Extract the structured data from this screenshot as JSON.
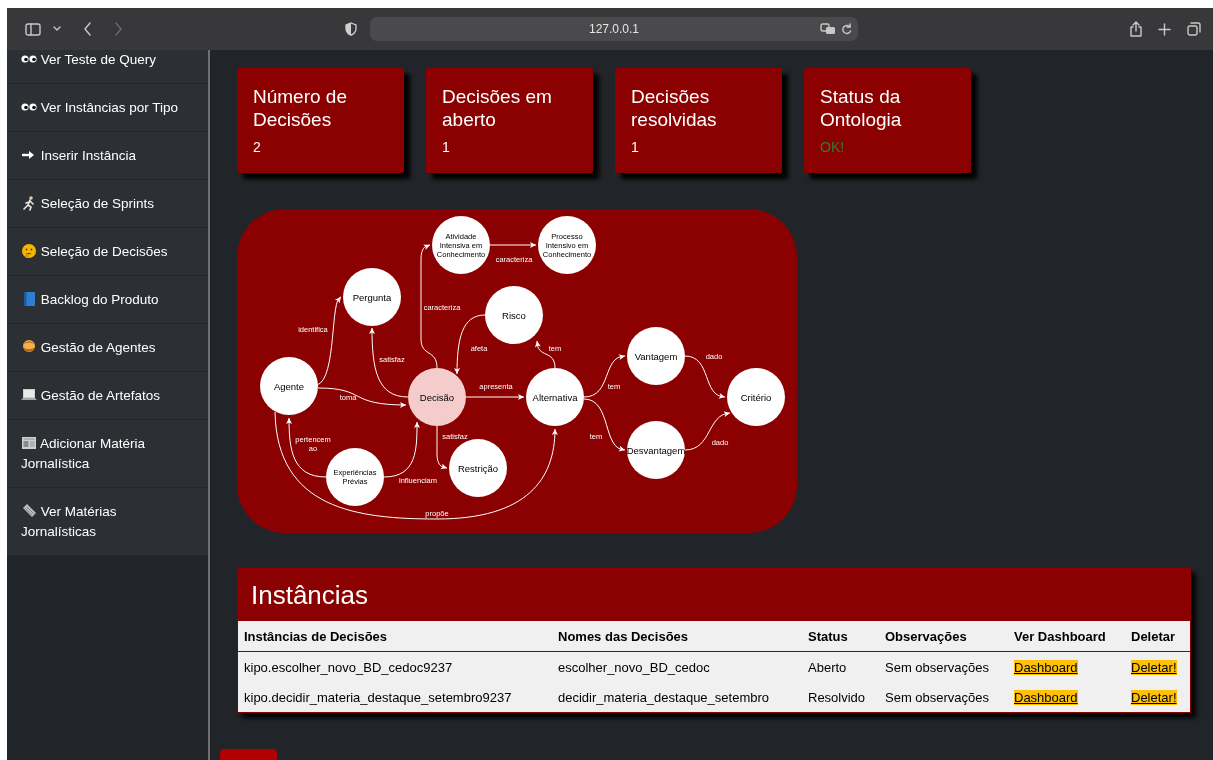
{
  "browser": {
    "url": "127.0.0.1"
  },
  "sidebar": {
    "items": [
      {
        "label": "Ver Teste de Query"
      },
      {
        "label": "Ver Instâncias por Tipo"
      },
      {
        "label": "Inserir Instância"
      },
      {
        "label": "Seleção de Sprints"
      },
      {
        "label": "Seleção de Decisões"
      },
      {
        "label": "Backlog do Produto"
      },
      {
        "label": "Gestão de Agentes"
      },
      {
        "label": "Gestão de Artefatos"
      },
      {
        "label": "Adicionar Matéria Jornalística"
      },
      {
        "label": "Ver Matérias Jornalísticas"
      }
    ]
  },
  "cards": [
    {
      "title": "Número de Decisões",
      "value": "2",
      "kind": "count"
    },
    {
      "title": "Decisões em aberto",
      "value": "1",
      "kind": "count"
    },
    {
      "title": "Decisões resolvidas",
      "value": "1",
      "kind": "count"
    },
    {
      "title": "Status da Ontologia",
      "value": "OK!",
      "kind": "status"
    }
  ],
  "diagram": {
    "nodes": [
      {
        "label": "Agente",
        "highlighted": false
      },
      {
        "label": "Pergunta",
        "highlighted": false
      },
      {
        "label": "Atividade Intensiva em Conhecimento",
        "highlighted": false
      },
      {
        "label": "Processo Intensivo em Conhecimento",
        "highlighted": false
      },
      {
        "label": "Risco",
        "highlighted": false
      },
      {
        "label": "Decisão",
        "highlighted": true
      },
      {
        "label": "Alternativa",
        "highlighted": false
      },
      {
        "label": "Vantagem",
        "highlighted": false
      },
      {
        "label": "Desvantagem",
        "highlighted": false
      },
      {
        "label": "Critério",
        "highlighted": false
      },
      {
        "label": "Restrição",
        "highlighted": false
      },
      {
        "label": "Experiências Prévias",
        "highlighted": false
      }
    ],
    "edges": [
      {
        "label": "identifica"
      },
      {
        "label": "satisfaz"
      },
      {
        "label": "caracteriza"
      },
      {
        "label": "caracteriza"
      },
      {
        "label": "afeta"
      },
      {
        "label": "tem"
      },
      {
        "label": "apresenta"
      },
      {
        "label": "toma"
      },
      {
        "label": "tem"
      },
      {
        "label": "tem"
      },
      {
        "label": "dado"
      },
      {
        "label": "dado"
      },
      {
        "label": "satisfaz"
      },
      {
        "label": "pertencem ao"
      },
      {
        "label": "influenciam"
      },
      {
        "label": "propõe"
      }
    ]
  },
  "instances": {
    "title": "Instâncias",
    "columns": [
      "Instâncias de Decisões",
      "Nomes das Decisões",
      "Status",
      "Observações",
      "Ver Dashboard",
      "Deletar"
    ],
    "rows": [
      {
        "instance": "kipo.escolher_novo_BD_cedoc9237",
        "name": "escolher_novo_BD_cedoc",
        "status": "Aberto",
        "notes": "Sem observações",
        "dashboard": "Dashboard",
        "delete": "Deletar!"
      },
      {
        "instance": "kipo.decidir_materia_destaque_setembro9237",
        "name": "decidir_materia_destaque_setembro",
        "status": "Resolvido",
        "notes": "Sem observações",
        "dashboard": "Dashboard",
        "delete": "Deletar!"
      }
    ]
  }
}
